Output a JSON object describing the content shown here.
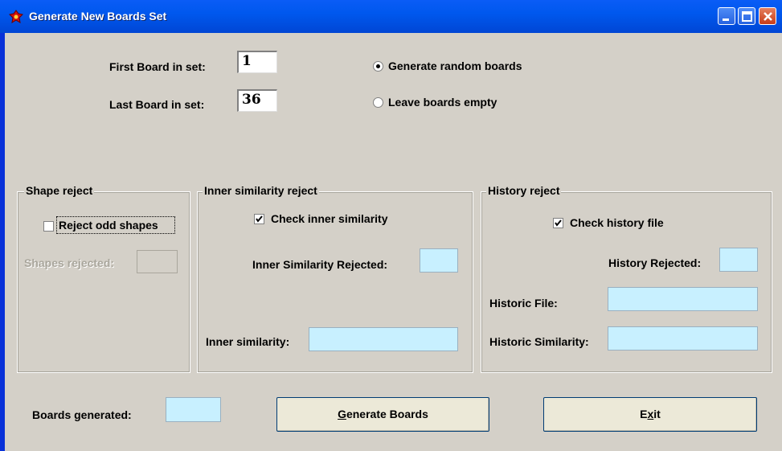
{
  "window": {
    "title": "Generate New Boards Set",
    "controls": {
      "minimize": "minimize-icon",
      "maximize": "maximize-icon",
      "close": "close-icon"
    }
  },
  "range": {
    "first_label": "First Board in set:",
    "first_value": "1",
    "last_label": "Last Board in set:",
    "last_value": "36"
  },
  "mode": {
    "options": [
      {
        "label": "Generate random boards",
        "selected": true
      },
      {
        "label": "Leave boards empty",
        "selected": false
      }
    ]
  },
  "shape_reject": {
    "legend": "Shape reject",
    "checkbox_label": "Reject odd shapes",
    "checked": false,
    "rejected_label": "Shapes rejected:",
    "rejected_value": ""
  },
  "inner_reject": {
    "legend": "Inner similarity reject",
    "checkbox_label": "Check inner similarity",
    "checked": true,
    "rejected_label": "Inner Similarity Rejected:",
    "rejected_value": "",
    "similarity_label": "Inner similarity:",
    "similarity_value": ""
  },
  "history_reject": {
    "legend": "History reject",
    "checkbox_label": "Check history file",
    "checked": true,
    "rejected_label": "History Rejected:",
    "rejected_value": "",
    "file_label": "Historic File:",
    "file_value": "",
    "similarity_label": "Historic Similarity:",
    "similarity_value": ""
  },
  "footer": {
    "generated_label": "Boards generated:",
    "generated_value": "",
    "generate_pre": "",
    "generate_accel": "G",
    "generate_post": "enerate Boards",
    "exit_pre": "E",
    "exit_accel": "x",
    "exit_post": "it"
  },
  "colors": {
    "titlebar": "#0058ee",
    "face": "#d4d0c8",
    "field_cyan": "#c8f0ff",
    "button_face": "#ece9d8"
  }
}
